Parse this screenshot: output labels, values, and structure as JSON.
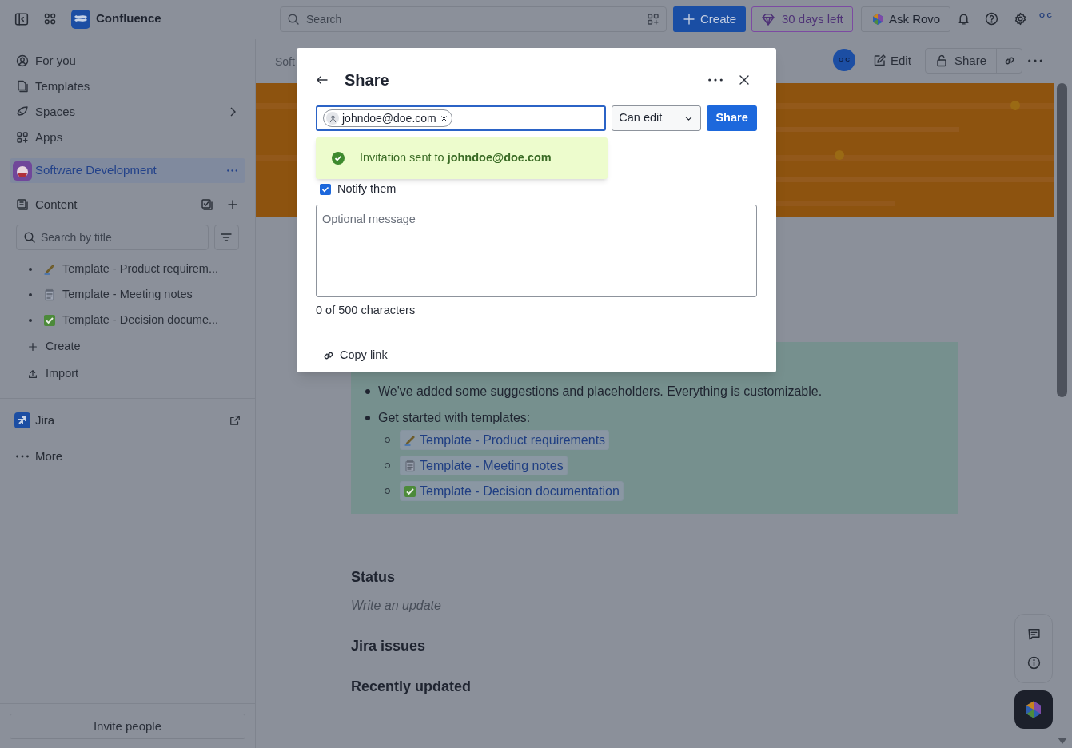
{
  "topbar": {
    "product": "Confluence",
    "search_placeholder": "Search",
    "create": "Create",
    "trial": "30 days left",
    "rovo": "Ask Rovo",
    "avatar": "O C"
  },
  "sidebar": {
    "nav": [
      {
        "label": "For you",
        "expandable": false
      },
      {
        "label": "Templates",
        "expandable": false
      },
      {
        "label": "Spaces",
        "expandable": true
      },
      {
        "label": "Apps",
        "expandable": false
      }
    ],
    "space": {
      "name": "Software Development",
      "selected": true
    },
    "content": {
      "label": "Content",
      "search_placeholder": "Search by title",
      "pages": [
        {
          "title": "Template - Product requirem..."
        },
        {
          "title": "Template - Meeting notes"
        },
        {
          "title": "Template - Decision docume..."
        }
      ],
      "actions": [
        {
          "label": "Create"
        },
        {
          "label": "Import"
        }
      ]
    },
    "apps": [
      {
        "label": "Jira"
      }
    ],
    "more": "More",
    "invite": "Invite people"
  },
  "page": {
    "breadcrumb": "Soft",
    "avatar": "O C",
    "edit": "Edit",
    "share": "Share",
    "bullets": [
      "We've added some suggestions and placeholders. Everything is customizable.",
      "Get started with templates:"
    ],
    "links": [
      {
        "title": "Template - Product requirements"
      },
      {
        "title": "Template - Meeting notes"
      },
      {
        "title": "Template - Decision documentation"
      }
    ],
    "sections": [
      {
        "heading": "Status",
        "placeholder": "Write an update"
      },
      {
        "heading": "Jira issues"
      },
      {
        "heading": "Recently updated"
      }
    ]
  },
  "modal": {
    "title": "Share",
    "recipient": "johndoe@doe.com",
    "permission": "Can edit",
    "share_button": "Share",
    "toast": "Invitation sent to **johndoe@doe.com**",
    "notify": {
      "label": "Notify them",
      "checked": true
    },
    "message_placeholder": "Optional message",
    "counter": "0 of 500 characters",
    "copy_link": "Copy link"
  }
}
